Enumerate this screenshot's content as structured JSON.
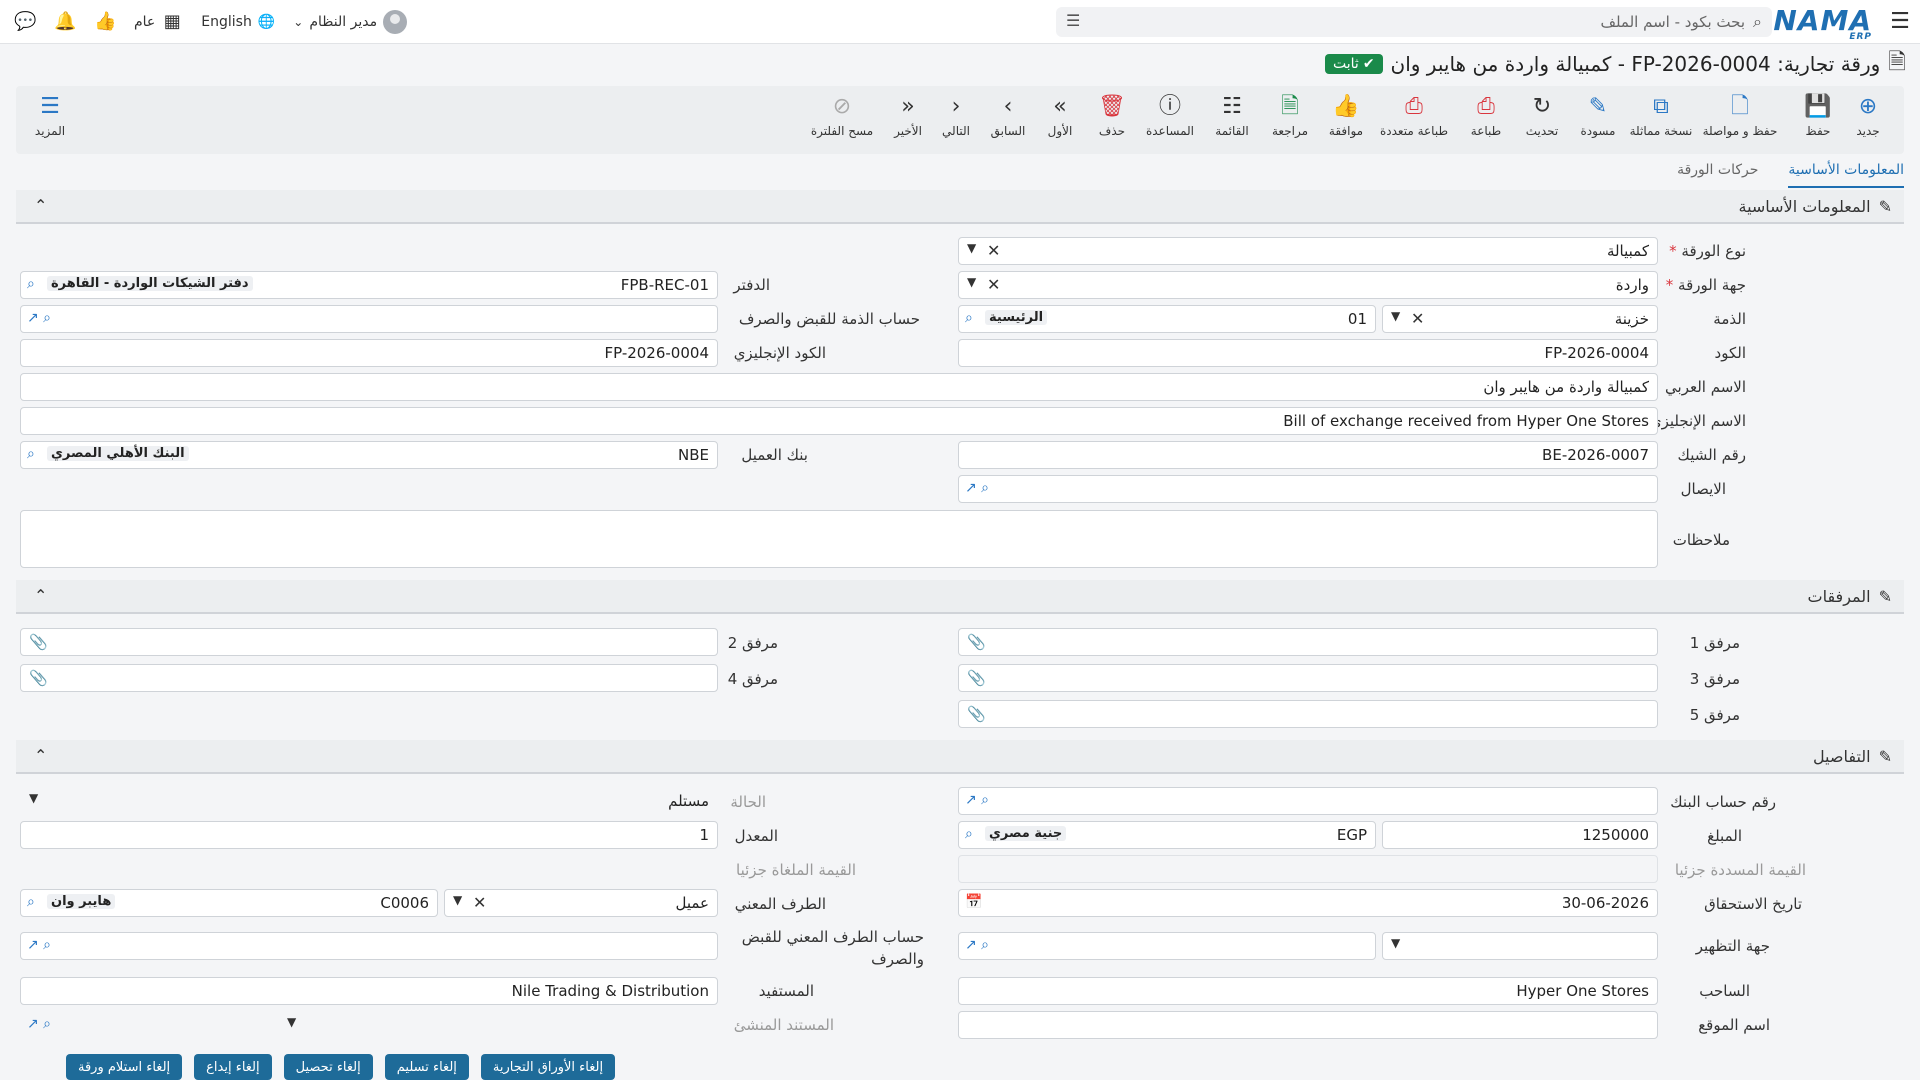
{
  "topbar": {
    "logo": "NAMA",
    "logo_sub": "ERP",
    "search_placeholder": "بحث بكود - اسم الملف",
    "user_name": "مدير النظام",
    "language": "English",
    "branch": "عام"
  },
  "title": {
    "text": "ورقة تجارية: FP-2026-0004 - كمبيالة واردة من هايبر وان",
    "status": "ثابت"
  },
  "toolbar": {
    "new": "جديد",
    "save": "حفظ",
    "save_continue": "حفظ و مواصلة",
    "duplicate": "نسخة مماثلة",
    "draft": "مسودة",
    "refresh": "تحديث",
    "print": "طباعة",
    "multi_print": "طباعة متعددة",
    "approve": "موافقة",
    "review": "مراجعة",
    "list": "القائمة",
    "help": "المساعدة",
    "delete": "حذف",
    "first": "الأول",
    "prev": "السابق",
    "next": "التالي",
    "last": "الأخير",
    "clear_filter": "مسح الفلترة",
    "more": "المزيد"
  },
  "tabs": [
    {
      "label": "المعلومات الأساسية"
    },
    {
      "label": "حركات الورقة"
    }
  ],
  "sections": {
    "basic": "المعلومات الأساسية",
    "attachments": "المرفقات",
    "details": "التفاصيل"
  },
  "basic": {
    "paper_type_label": "نوع الورقة",
    "paper_type": "كمبيالة",
    "paper_side_label": "جهة الورقة",
    "paper_side": "واردة",
    "ledger_label": "الدفتر",
    "ledger_code": "FPB-REC-01",
    "ledger_name": "دفتر الشيكات الواردة - القاهرة",
    "account_label": "الذمة",
    "account_type": "خزينة",
    "account_code": "01",
    "account_name": "الرئيسية",
    "receipt_account_label": "حساب الذمة للقبض والصرف",
    "code_label": "الكود",
    "code": "FP-2026-0004",
    "en_code_label": "الكود الإنجليزي",
    "en_code": "FP-2026-0004",
    "ar_name_label": "الاسم العربي",
    "ar_name": "كمبيالة واردة من هايبر وان",
    "en_name_label": "الاسم الإنجليزي",
    "en_name": "Bill of exchange received from Hyper One Stores",
    "cheque_no_label": "رقم الشيك",
    "cheque_no": "BE-2026-0007",
    "client_bank_label": "بنك العميل",
    "client_bank_code": "NBE",
    "client_bank_name": "البنك الأهلي المصري",
    "receipt_label": "الايصال",
    "notes_label": "ملاحظات"
  },
  "attachments": {
    "a1": "مرفق 1",
    "a2": "مرفق 2",
    "a3": "مرفق 3",
    "a4": "مرفق 4",
    "a5": "مرفق 5"
  },
  "details": {
    "bank_account_label": "رقم حساب البنك",
    "status_label": "الحالة",
    "status": "مستلم",
    "amount_label": "المبلغ",
    "amount": "1250000",
    "currency_code": "EGP",
    "currency_name": "جنية مصري",
    "rate_label": "المعدل",
    "rate": "1",
    "partial_paid_label": "القيمة المسددة جزئيا",
    "partial_cancel_label": "القيمة الملغاة جزئيا",
    "due_date_label": "تاريخ الاستحقاق",
    "due_date": "30-06-2026",
    "party_label": "الطرف المعني",
    "party_type": "عميل",
    "party_code": "C0006",
    "party_name": "هايبر وان",
    "endorse_label": "جهة التظهير",
    "party_account_label": "حساب الطرف المعني للقبض والصرف",
    "drawer_label": "الساحب",
    "drawer": "Hyper One Stores",
    "beneficiary_label": "المستفيد",
    "beneficiary": "Nile Trading & Distribution",
    "site_label": "اسم الموقع",
    "source_doc_label": "المستند المنشئ"
  },
  "footer": {
    "btn1": "إلغاء استلام ورقة",
    "btn2": "إلغاء إيداع",
    "btn3": "إلغاء تحصيل",
    "btn4": "إلغاء تسليم",
    "btn5": "إلغاء الأوراق التجارية"
  }
}
